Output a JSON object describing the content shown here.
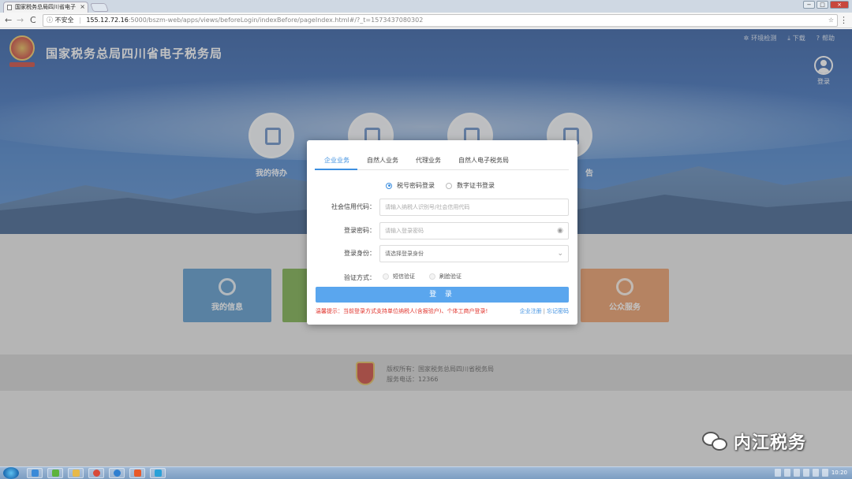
{
  "browser": {
    "tab_title": "国家税务总局四川省电子",
    "tab_close": "×",
    "nav_back": "←",
    "nav_forward": "→",
    "nav_reload": "C",
    "security_label": "不安全",
    "url_host": "155.12.72.16",
    "url_path": ":5000/bszm-web/apps/views/beforeLogin/indexBefore/pageIndex.html#/?_t=1573437080302",
    "bookmark_star": "☆",
    "menu": "⋮",
    "win_min": "−",
    "win_max": "□",
    "win_close": "×"
  },
  "header": {
    "site_title": "国家税务总局四川省电子税务局",
    "links": [
      {
        "icon": "✲",
        "label": "环境检测"
      },
      {
        "icon": "⤓",
        "label": "下载"
      },
      {
        "icon": "?",
        "label": "帮助"
      }
    ],
    "login_label": "登录"
  },
  "services": [
    {
      "label": "我的待办"
    },
    {
      "label": ""
    },
    {
      "label": ""
    },
    {
      "label": "告"
    }
  ],
  "tiles": [
    {
      "label": "我的信息",
      "color": "#4a90c8"
    },
    {
      "label": "",
      "color": "#6ea83c"
    },
    {
      "label": "公众服务",
      "color": "#e8935a"
    }
  ],
  "footer": {
    "copyright": "版权所有：国家税务总局四川省税务局",
    "phone": "服务电话：12366"
  },
  "modal": {
    "tabs": [
      "企业业务",
      "自然人业务",
      "代理业务",
      "自然人电子税务局"
    ],
    "active_tab": 0,
    "login_modes": [
      {
        "label": "税号密码登录",
        "selected": true
      },
      {
        "label": "数字证书登录",
        "selected": false
      }
    ],
    "fields": {
      "credit_code_label": "社会信用代码：",
      "credit_code_placeholder": "请输入纳税人识别号/社会信用代码",
      "password_label": "登录密码：",
      "password_placeholder": "请输入登录密码",
      "identity_label": "登录身份：",
      "identity_placeholder": "请选择登录身份",
      "verify_label": "验证方式："
    },
    "verify_options": [
      {
        "label": "短信验证"
      },
      {
        "label": "刷脸验证"
      }
    ],
    "login_button": "登 录",
    "notice": "温馨提示：当前登录方式支持单位纳税人(含报验户)、个体工商户登录!",
    "register_link": "企业注册",
    "separator": "|",
    "forgot_link": "忘记密码"
  },
  "watermark": "内江税务",
  "taskbar": {
    "clock": "10:20"
  },
  "colors": {
    "accent": "#3d8fe0",
    "button": "#5aa6ee",
    "warning": "#e0312a"
  }
}
